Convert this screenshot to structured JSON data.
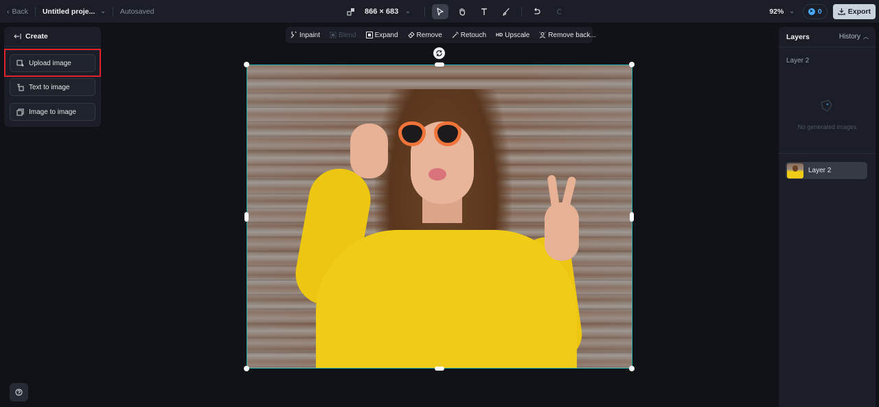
{
  "topbar": {
    "back_label": "Back",
    "project_title": "Untitled proje...",
    "save_status": "Autosaved",
    "canvas_size": "866 × 683",
    "tools": [
      {
        "name": "select-tool",
        "icon": "pointer-icon",
        "active": true
      },
      {
        "name": "hand-tool",
        "icon": "hand-icon"
      },
      {
        "name": "text-tool",
        "icon": "text-icon"
      },
      {
        "name": "brush-tool",
        "icon": "brush-icon"
      }
    ],
    "zoom_level": "92%",
    "credits": "0",
    "export_label": "Export"
  },
  "left_panel": {
    "header": "Create",
    "buttons": [
      {
        "label": "Upload image",
        "icon": "upload-image-icon",
        "highlighted": true
      },
      {
        "label": "Text to image",
        "icon": "text-to-image-icon"
      },
      {
        "label": "Image to image",
        "icon": "image-to-image-icon"
      }
    ]
  },
  "edit_toolbar": {
    "items": [
      {
        "label": "Inpaint",
        "icon": "inpaint-icon",
        "enabled": true
      },
      {
        "label": "Blend",
        "icon": "blend-icon",
        "enabled": false
      },
      {
        "label": "Expand",
        "icon": "expand-icon",
        "enabled": true
      },
      {
        "label": "Remove",
        "icon": "eraser-icon",
        "enabled": true
      },
      {
        "label": "Retouch",
        "icon": "magic-wand-icon",
        "enabled": true
      },
      {
        "label": "Upscale",
        "icon": "hd-icon",
        "icon_text": "HD",
        "enabled": true
      },
      {
        "label": "Remove back...",
        "icon": "remove-background-icon",
        "enabled": true
      }
    ]
  },
  "canvas": {
    "image_description": "Woman in yellow sweater with heart-shaped orange sunglasses making peace sign against wooden wall",
    "selection_color": "#1fb5ad"
  },
  "right_panel": {
    "title": "Layers",
    "history_label": "History",
    "current_layer": "Layer 2",
    "empty_message": "No generated images",
    "layers": [
      {
        "label": "Layer 2",
        "selected": true
      }
    ]
  },
  "colors": {
    "background": "#101217",
    "panel": "#1b1e26",
    "accent_blue": "#4aa8ff",
    "highlight_red": "#e2222b",
    "export_bg": "#c9d3dd"
  }
}
